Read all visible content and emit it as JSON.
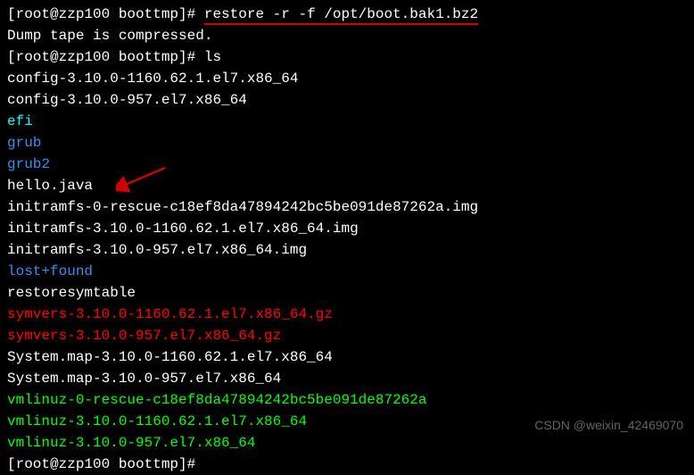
{
  "prompt1": {
    "prefix": "[root@zzp100 boottmp]# ",
    "cmd": "restore -r -f /opt/boot.bak1.bz2"
  },
  "msg": "Dump tape is compressed.",
  "prompt2": {
    "prefix": "[root@zzp100 boottmp]# ",
    "cmd": "ls"
  },
  "files": {
    "config1": "config-3.10.0-1160.62.1.el7.x86_64",
    "config2": "config-3.10.0-957.el7.x86_64",
    "efi": "efi",
    "grub": "grub",
    "grub2": "grub2",
    "hello": "hello.java",
    "initramfs0": "initramfs-0-rescue-c18ef8da47894242bc5be091de87262a.img",
    "initramfs1": "initramfs-3.10.0-1160.62.1.el7.x86_64.img",
    "initramfs2": "initramfs-3.10.0-957.el7.x86_64.img",
    "lostfound": "lost+found",
    "restoresym": "restoresymtable",
    "symvers1": "symvers-3.10.0-1160.62.1.el7.x86_64.gz",
    "symvers2": "symvers-3.10.0-957.el7.x86_64.gz",
    "sysmap1": "System.map-3.10.0-1160.62.1.el7.x86_64",
    "sysmap2": "System.map-3.10.0-957.el7.x86_64",
    "vmlinuz0": "vmlinuz-0-rescue-c18ef8da47894242bc5be091de87262a",
    "vmlinuz1": "vmlinuz-3.10.0-1160.62.1.el7.x86_64",
    "vmlinuz2": "vmlinuz-3.10.0-957.el7.x86_64"
  },
  "prompt3": "[root@zzp100 boottmp]#",
  "watermark": "CSDN @weixin_42469070"
}
